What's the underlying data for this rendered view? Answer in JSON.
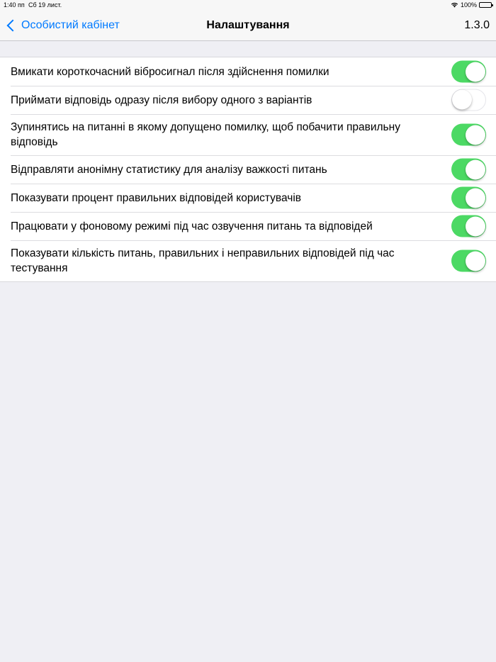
{
  "status_bar": {
    "time": "1:40 пп",
    "date": "Сб 19 лист.",
    "battery": "100%"
  },
  "nav": {
    "back_label": "Особистий кабінет",
    "title": "Налаштування",
    "version": "1.3.0"
  },
  "settings": [
    {
      "label": "Вмикати короткочасний вібросигнал після здійснення помилки",
      "on": true
    },
    {
      "label": "Приймати відповідь одразу після вибору одного з варіантів",
      "on": false
    },
    {
      "label": "Зупинятись на питанні в якому допущено помилку, щоб побачити правильну відповідь",
      "on": true
    },
    {
      "label": "Відправляти анонімну статистику для аналізу важкості питань",
      "on": true
    },
    {
      "label": "Показувати процент правильних відповідей користувачів",
      "on": true
    },
    {
      "label": "Працювати у фоновому режимі під час озвучення питань та відповідей",
      "on": true
    },
    {
      "label": "Показувати кількість питань, правильних і неправильних відповідей під час тестування",
      "on": true
    }
  ],
  "colors": {
    "accent": "#007aff",
    "toggle_on": "#4cd964",
    "background": "#efeff4"
  }
}
